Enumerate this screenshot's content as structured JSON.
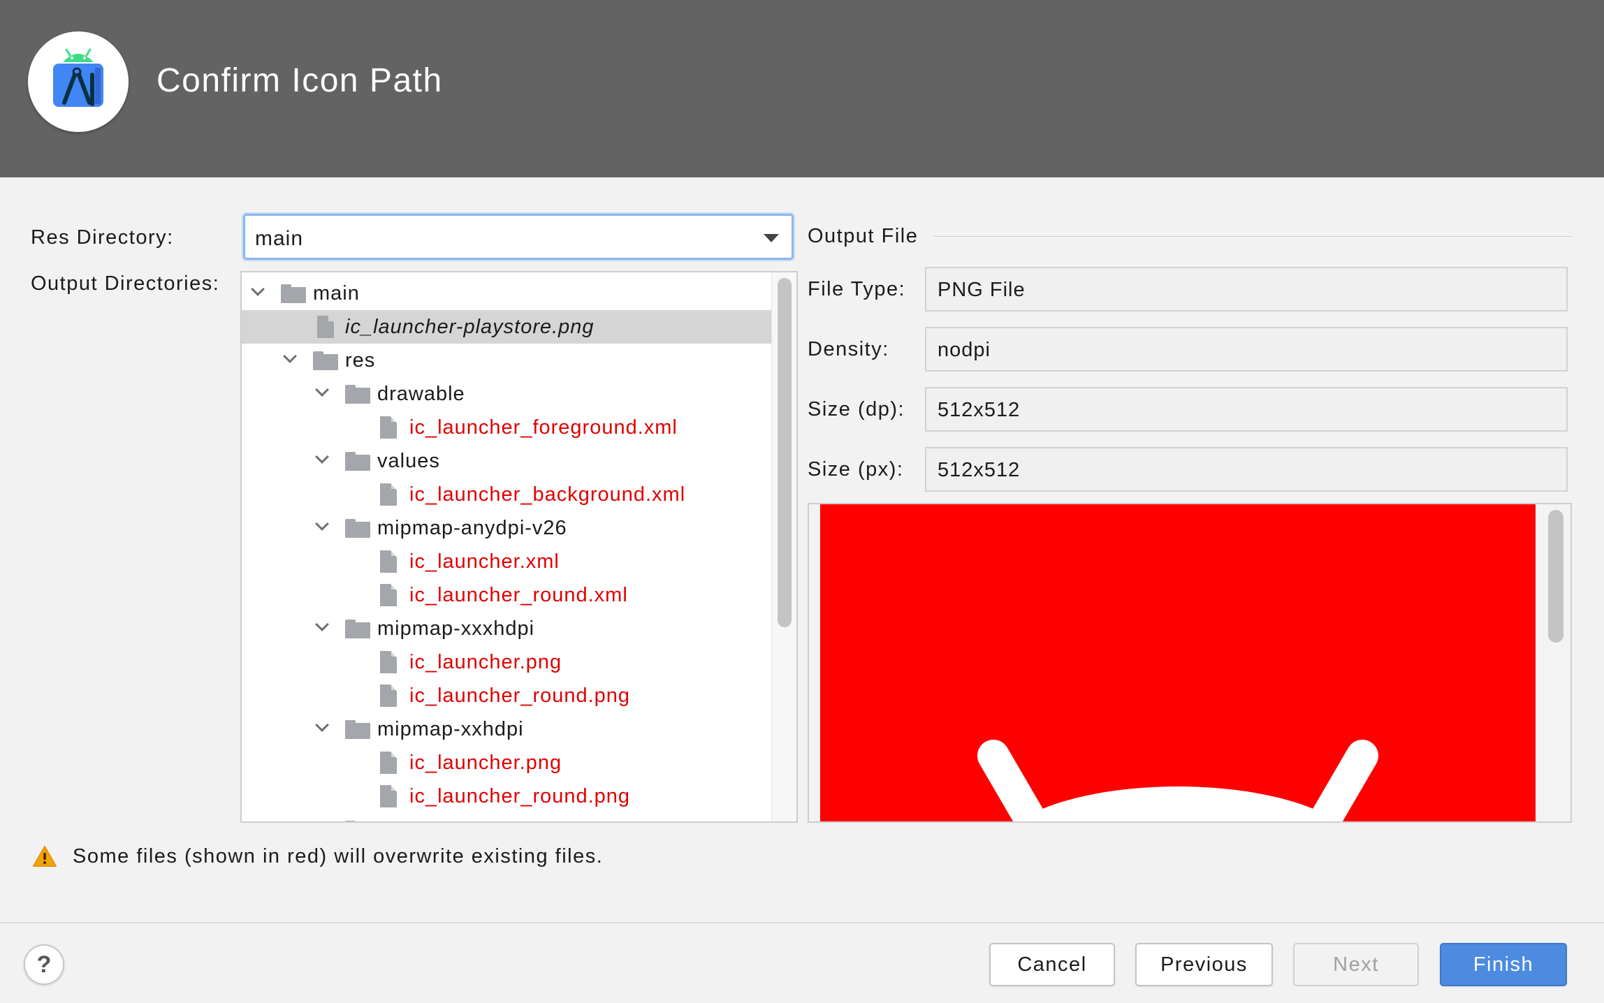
{
  "header": {
    "title": "Confirm Icon Path",
    "logo_icon": "android-studio-logo-icon"
  },
  "res_directory": {
    "label": "Res Directory:",
    "value": "main"
  },
  "output_directories": {
    "label": "Output Directories:",
    "tree": [
      {
        "text": "main",
        "type": "folder",
        "expanded": true,
        "overwrite": false
      },
      {
        "text": "ic_launcher-playstore.png",
        "type": "file",
        "selected": true,
        "italic": true,
        "overwrite": false
      },
      {
        "text": "res",
        "type": "folder",
        "expanded": true,
        "overwrite": false
      },
      {
        "text": "drawable",
        "type": "folder",
        "expanded": true,
        "overwrite": false
      },
      {
        "text": "ic_launcher_foreground.xml",
        "type": "file",
        "overwrite": true
      },
      {
        "text": "values",
        "type": "folder",
        "expanded": true,
        "overwrite": false
      },
      {
        "text": "ic_launcher_background.xml",
        "type": "file",
        "overwrite": true
      },
      {
        "text": "mipmap-anydpi-v26",
        "type": "folder",
        "expanded": true,
        "overwrite": false
      },
      {
        "text": "ic_launcher.xml",
        "type": "file",
        "overwrite": true
      },
      {
        "text": "ic_launcher_round.xml",
        "type": "file",
        "overwrite": true
      },
      {
        "text": "mipmap-xxxhdpi",
        "type": "folder",
        "expanded": true,
        "overwrite": false
      },
      {
        "text": "ic_launcher.png",
        "type": "file",
        "overwrite": true
      },
      {
        "text": "ic_launcher_round.png",
        "type": "file",
        "overwrite": true
      },
      {
        "text": "mipmap-xxhdpi",
        "type": "folder",
        "expanded": true,
        "overwrite": false
      },
      {
        "text": "ic_launcher.png",
        "type": "file",
        "overwrite": true
      },
      {
        "text": "ic_launcher_round.png",
        "type": "file",
        "overwrite": true
      }
    ]
  },
  "output_file": {
    "section_title": "Output File",
    "file_type_label": "File Type:",
    "file_type_value": "PNG File",
    "density_label": "Density:",
    "density_value": "nodpi",
    "size_dp_label": "Size (dp):",
    "size_dp_value": "512x512",
    "size_px_label": "Size (px):",
    "size_px_value": "512x512",
    "preview_background": "#ff0000"
  },
  "warning": {
    "icon": "warning-triangle-icon",
    "text": "Some files (shown in red) will overwrite existing files."
  },
  "footer": {
    "help_label": "?",
    "cancel_label": "Cancel",
    "previous_label": "Previous",
    "next_label": "Next",
    "finish_label": "Finish"
  },
  "colors": {
    "header_bg": "#636363",
    "overwrite_text": "#e00000",
    "primary_button": "#4c8be0"
  }
}
